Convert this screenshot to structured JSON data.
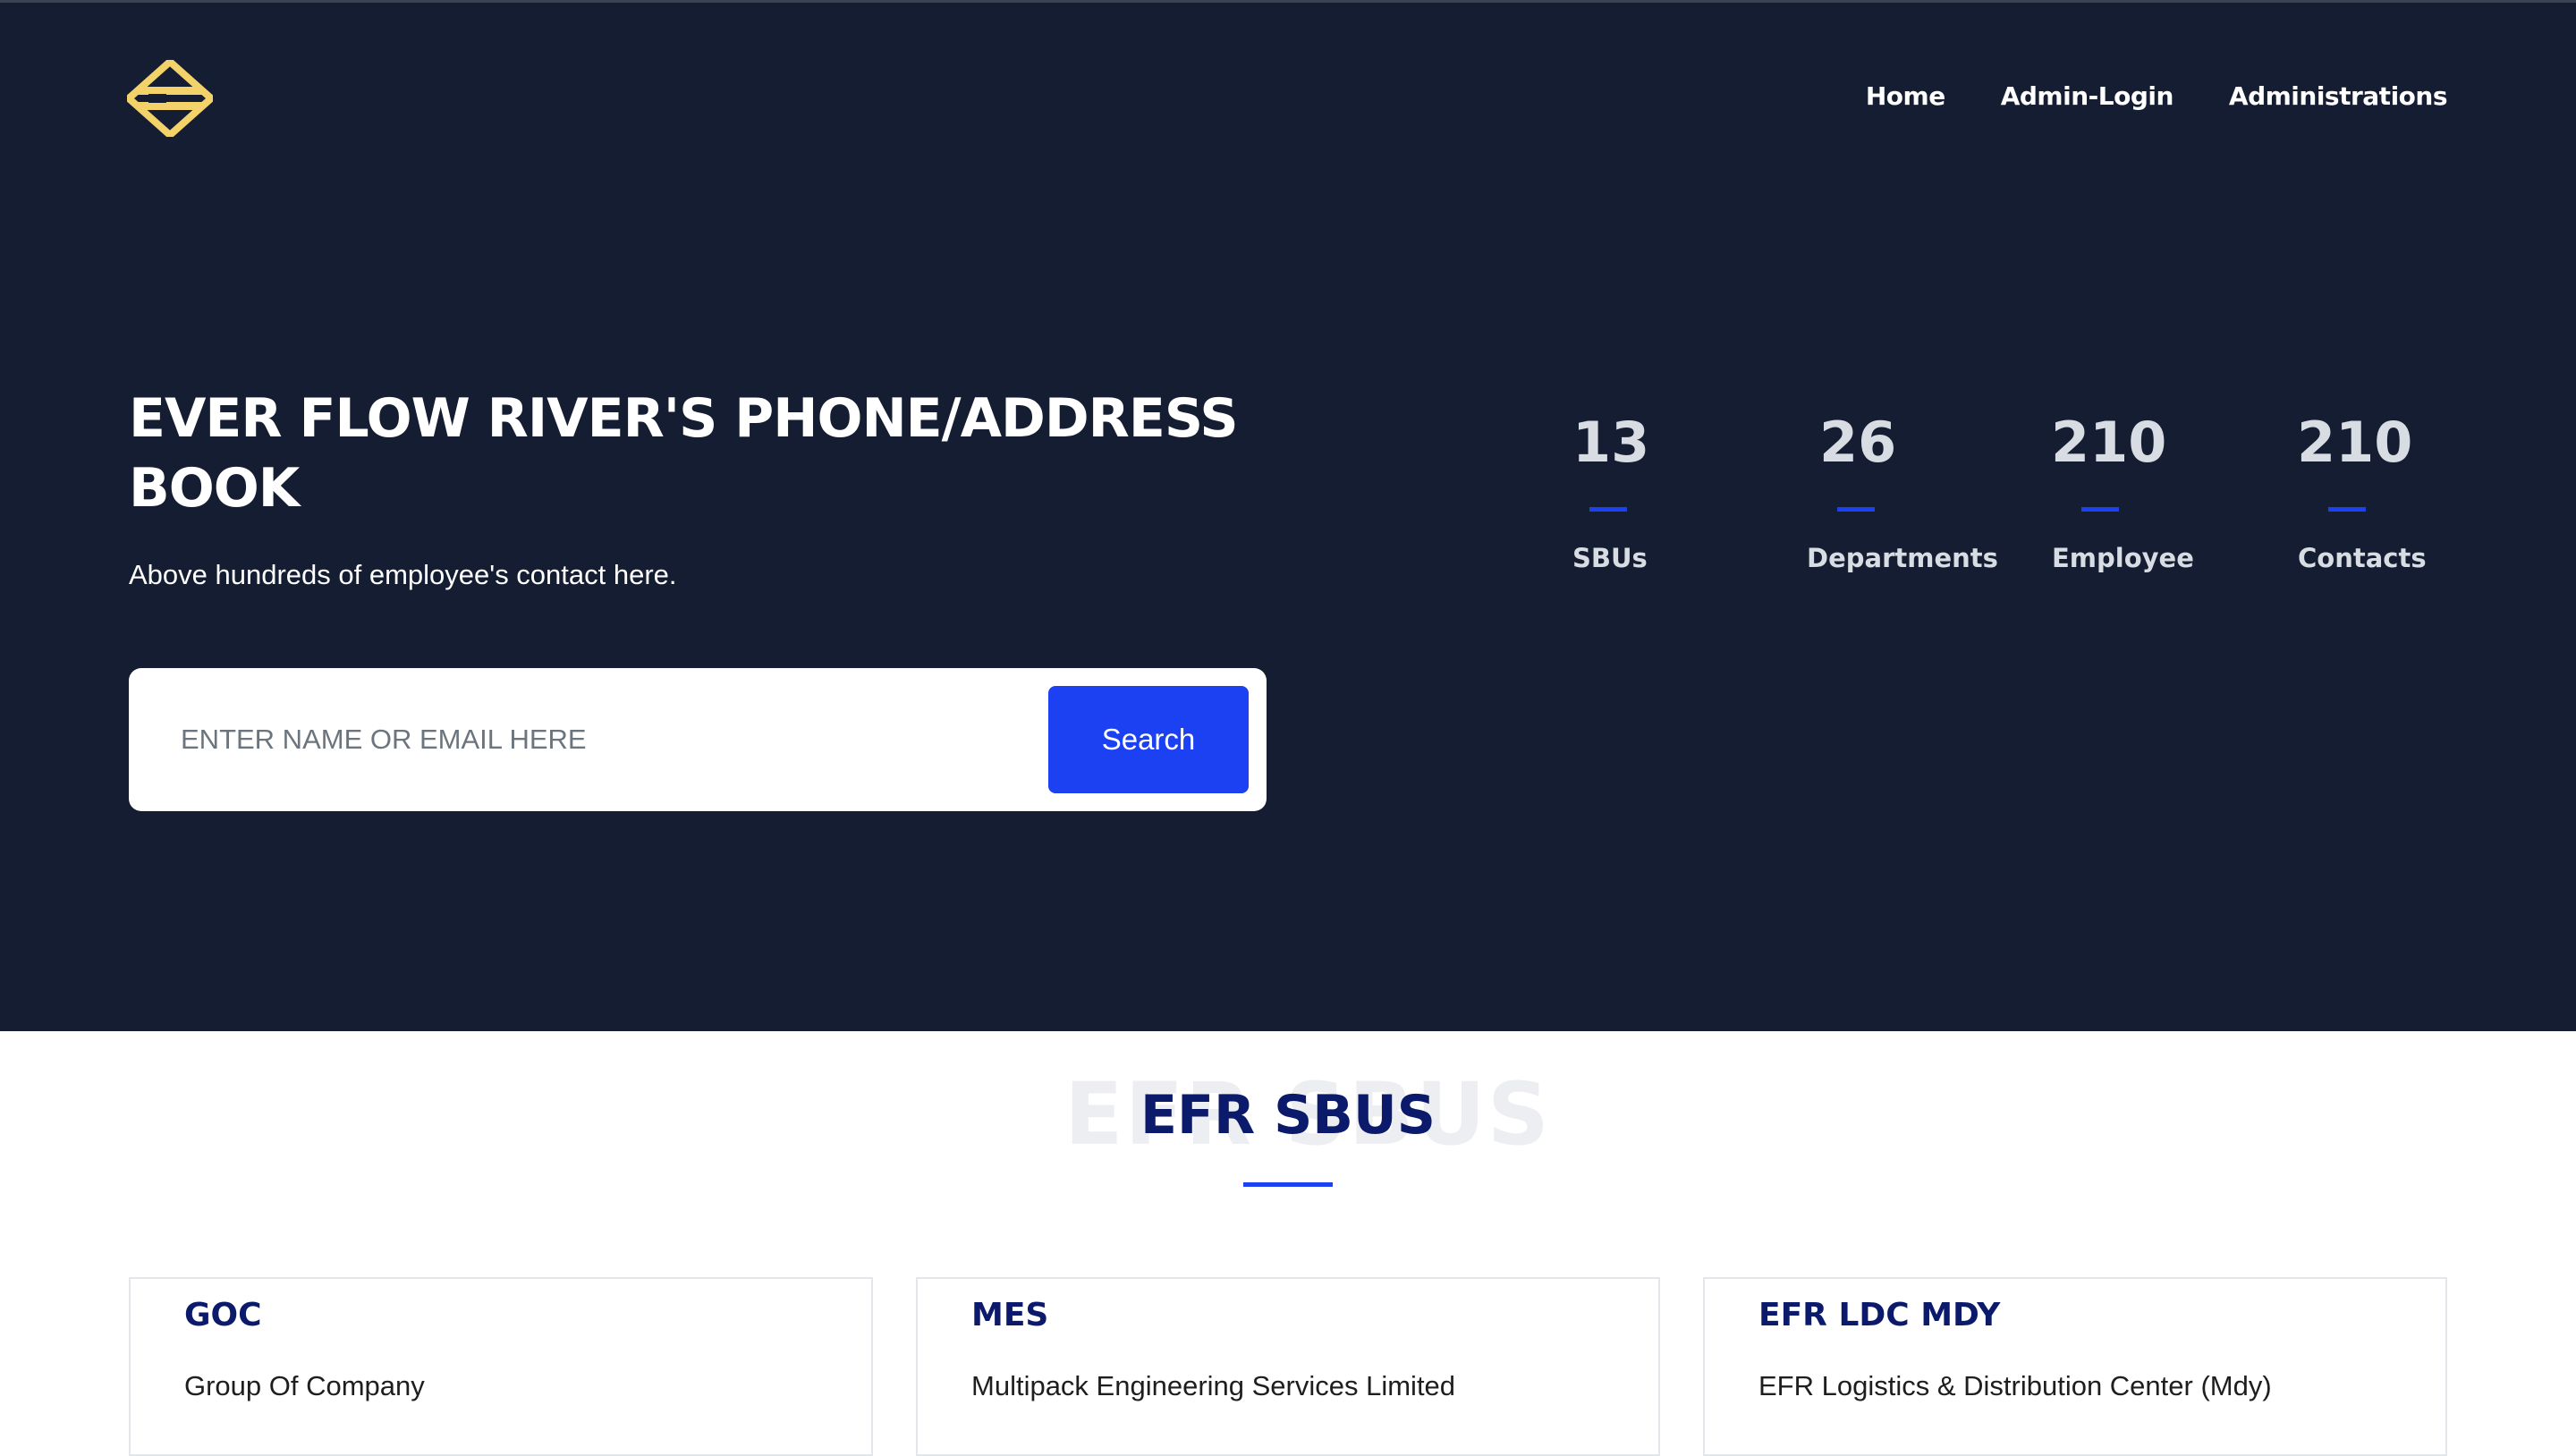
{
  "nav": {
    "items": [
      {
        "label": "Home"
      },
      {
        "label": "Admin-Login"
      },
      {
        "label": "Administrations"
      }
    ]
  },
  "hero": {
    "title": "EVER FLOW RIVER'S PHONE/ADDRESS BOOK",
    "subtitle": "Above hundreds of employee's contact here.",
    "search_placeholder": "ENTER NAME OR EMAIL HERE",
    "search_button": "Search"
  },
  "stats": [
    {
      "value": "13",
      "label": "SBUs"
    },
    {
      "value": "26",
      "label": "Departments"
    },
    {
      "value": "210",
      "label": "Employee"
    },
    {
      "value": "210",
      "label": "Contacts"
    }
  ],
  "section": {
    "ghost_text": "EFR SBUS",
    "title": "EFR SBUS"
  },
  "cards": [
    {
      "code": "GOC",
      "name": "Group Of Company"
    },
    {
      "code": "MES",
      "name": "Multipack Engineering Services Limited"
    },
    {
      "code": "EFR LDC MDY",
      "name": "EFR Logistics & Distribution Center (Mdy)"
    }
  ],
  "colors": {
    "hero_bg": "#141d31",
    "accent": "#1c41f2",
    "heading_navy": "#0c1a6c",
    "logo_gold": "#f4d26a"
  },
  "icons": {
    "logo": "efr-logo-icon"
  }
}
